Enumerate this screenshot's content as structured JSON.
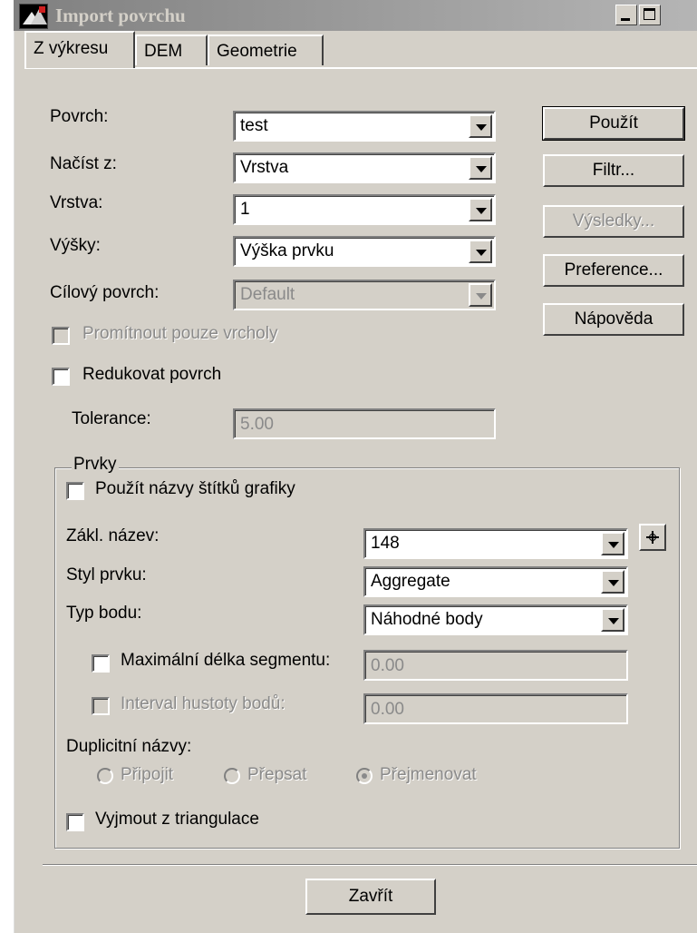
{
  "window": {
    "title": "Import povrchu"
  },
  "tabs": [
    "Z výkresu",
    "DEM",
    "Geometrie"
  ],
  "form": {
    "povrch": {
      "label": "Povrch:",
      "value": "test"
    },
    "nacist_z": {
      "label": "Načíst z:",
      "value": "Vrstva"
    },
    "vrstva": {
      "label": "Vrstva:",
      "value": "1"
    },
    "vysky": {
      "label": "Výšky:",
      "value": "Výška prvku"
    },
    "cilovy_povrch": {
      "label": "Cílový povrch:",
      "value": "Default"
    },
    "promitnout": {
      "label": "Promítnout pouze vrcholy"
    },
    "redukovat": {
      "label": "Redukovat povrch"
    },
    "tolerance": {
      "label": "Tolerance:",
      "value": "5.00"
    }
  },
  "buttons": {
    "pouzit": "Použít",
    "filtr": "Filtr...",
    "vysledky": "Výsledky...",
    "preference": "Preference...",
    "napoveda": "Nápověda",
    "zavrit": "Zavřít"
  },
  "prvky": {
    "title": "Prvky",
    "use_labels": "Použít názvy štítků grafiky",
    "zakl_nazev": {
      "label": "Zákl. název:",
      "value": "148"
    },
    "styl_prvku": {
      "label": "Styl prvku:",
      "value": "Aggregate"
    },
    "typ_bodu": {
      "label": "Typ bodu:",
      "value": "Náhodné body"
    },
    "max_delka": {
      "label": "Maximální délka segmentu:",
      "value": "0.00"
    },
    "interval": {
      "label": "Interval hustoty bodů:",
      "value": "0.00"
    },
    "duplicitni": {
      "label": "Duplicitní názvy:",
      "options": [
        "Připojit",
        "Přepsat",
        "Přejmenovat"
      ],
      "selected": "Přejmenovat"
    },
    "vyjmout": "Vyjmout z triangulace"
  }
}
